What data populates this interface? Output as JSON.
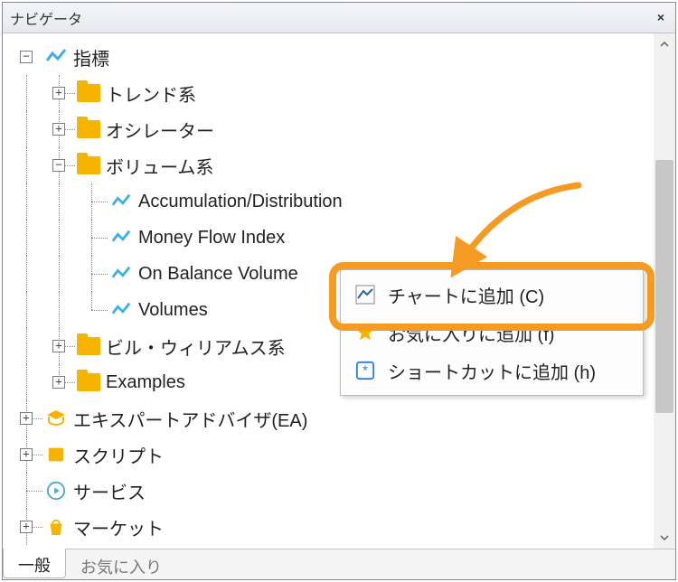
{
  "window": {
    "title": "ナビゲータ"
  },
  "tree": {
    "root": {
      "label": "指標"
    },
    "trend": {
      "label": "トレンド系"
    },
    "oscillator": {
      "label": "オシレーター"
    },
    "volume": {
      "label": "ボリューム系"
    },
    "volumeIndicators": {
      "ad": "Accumulation/Distribution",
      "mfi": "Money Flow Index",
      "obv": "On Balance Volume",
      "vol": "Volumes"
    },
    "bill": {
      "label": "ビル・ウィリアムス系"
    },
    "examples": {
      "label": "Examples"
    },
    "ea": {
      "label": "エキスパートアドバイザ(EA)"
    },
    "script": {
      "label": "スクリプト"
    },
    "service": {
      "label": "サービス"
    },
    "market": {
      "label": "マーケット"
    }
  },
  "ctx": {
    "addChart": "チャートに追加 (C)",
    "addFav": "お気に入りに追加 (f)",
    "addShortcut": "ショートカットに追加 (h)"
  },
  "tabs": {
    "general": "一般",
    "favorites": "お気に入り"
  },
  "colors": {
    "accent": "#f59a22",
    "folder": "#f6b400"
  }
}
